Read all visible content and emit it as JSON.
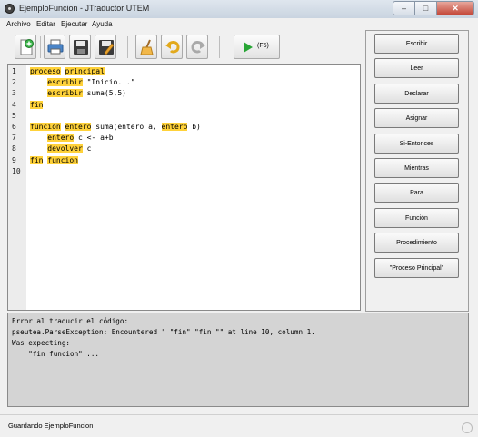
{
  "window": {
    "title": "EjemploFuncion - JTraductor UTEM",
    "controls": [
      "minimize",
      "maximize",
      "close"
    ]
  },
  "menu": [
    "Archivo",
    "Editar",
    "Ejecutar",
    "Ayuda"
  ],
  "toolbar": {
    "buttons": [
      {
        "name": "new-file",
        "icon": "new-file-icon"
      },
      {
        "name": "print",
        "icon": "printer-icon"
      },
      {
        "name": "save",
        "icon": "floppy-disk-icon"
      },
      {
        "name": "save-as",
        "icon": "save-as-icon"
      },
      {
        "name": "clear",
        "icon": "broom-icon"
      },
      {
        "name": "undo",
        "icon": "undo-icon"
      },
      {
        "name": "redo",
        "icon": "redo-icon"
      }
    ],
    "run_label": "(F5)"
  },
  "editor": {
    "lines": [
      {
        "n": "1",
        "segs": [
          {
            "t": "proceso",
            "kw": true
          },
          {
            "t": " "
          },
          {
            "t": "principal",
            "kw": true
          }
        ]
      },
      {
        "n": "2",
        "segs": [
          {
            "t": "    "
          },
          {
            "t": "escribir",
            "kw": true
          },
          {
            "t": " \"Inicio...\""
          }
        ]
      },
      {
        "n": "3",
        "segs": [
          {
            "t": "    "
          },
          {
            "t": "escribir",
            "kw": true
          },
          {
            "t": " suma(5,5)"
          }
        ]
      },
      {
        "n": "4",
        "segs": [
          {
            "t": "fin",
            "kw": true
          }
        ]
      },
      {
        "n": "5",
        "segs": []
      },
      {
        "n": "6",
        "segs": [
          {
            "t": "funcion",
            "kw": true
          },
          {
            "t": " "
          },
          {
            "t": "entero",
            "kw": true
          },
          {
            "t": " suma(entero a, "
          },
          {
            "t": "entero",
            "kw": true
          },
          {
            "t": " b)"
          }
        ]
      },
      {
        "n": "7",
        "segs": [
          {
            "t": "    "
          },
          {
            "t": "entero",
            "kw": true
          },
          {
            "t": " c <- a+b"
          }
        ]
      },
      {
        "n": "8",
        "segs": [
          {
            "t": "    "
          },
          {
            "t": "devolver",
            "kw": true
          },
          {
            "t": " c"
          }
        ]
      },
      {
        "n": "9",
        "segs": [
          {
            "t": "fin",
            "kw": true
          },
          {
            "t": " "
          },
          {
            "t": "funcion",
            "kw": true
          }
        ]
      },
      {
        "n": "10",
        "segs": []
      }
    ]
  },
  "side_buttons": [
    "Escribir",
    "Leer",
    "Declarar",
    "Asignar",
    "Si-Entonces",
    "Mientras",
    "Para",
    "Función",
    "Procedimiento",
    "\"Proceso Principal\""
  ],
  "console": {
    "lines": [
      "Error al traducir el código:",
      "pseutea.ParseException: Encountered \" \"fin\" \"fin \"\" at line 10, column 1.",
      "Was expecting:",
      "    \"fin funcion\" ..."
    ]
  },
  "status": {
    "text": "Guardando EjemploFuncion"
  },
  "colors": {
    "keyword_highlight": "#ffd23a",
    "console_bg": "#d4d4d4",
    "run_icon": "#27a535"
  }
}
